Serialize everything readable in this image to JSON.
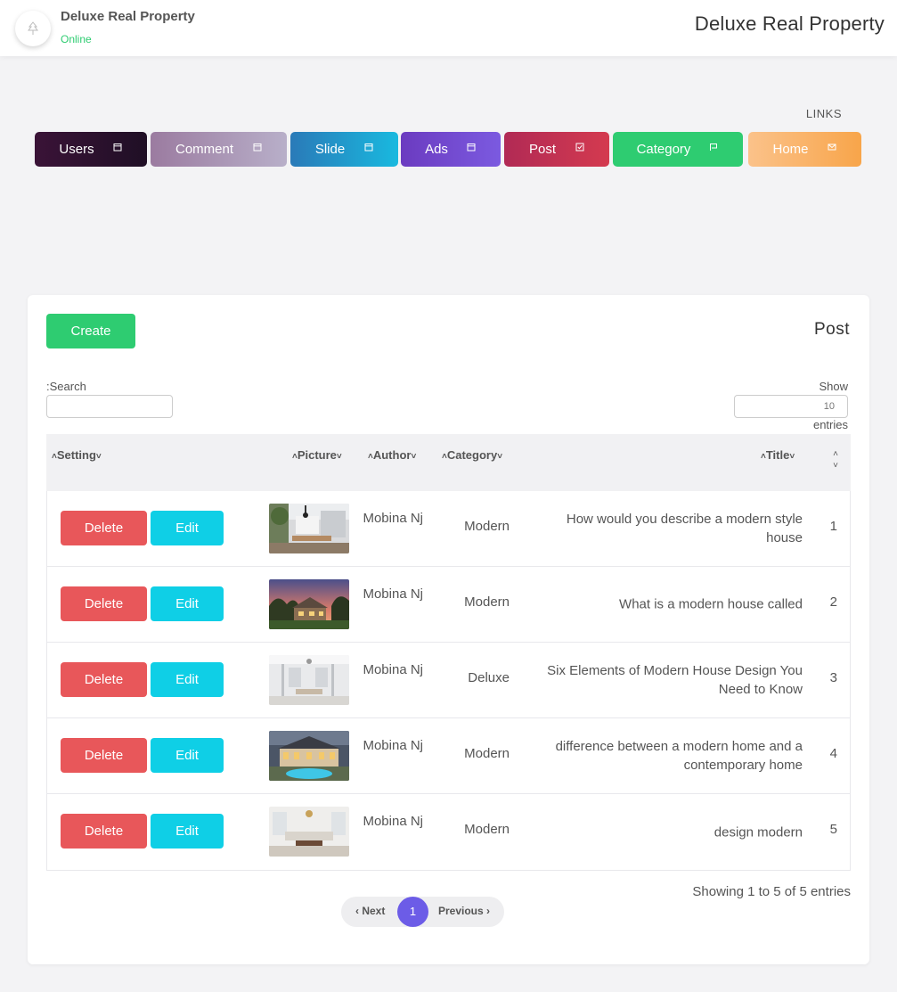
{
  "header": {
    "brand": "Deluxe Real Property",
    "status": "Online",
    "page_heading": "Deluxe Real Property",
    "status_color": "#2ecc71"
  },
  "links": {
    "label": "LINKS",
    "items": [
      {
        "label": "Users",
        "icon": "calendar-icon"
      },
      {
        "label": "Comment",
        "icon": "calendar-icon"
      },
      {
        "label": "Slide",
        "icon": "calendar-icon"
      },
      {
        "label": "Ads",
        "icon": "calendar-icon"
      },
      {
        "label": "Post",
        "icon": "checkbox-icon"
      },
      {
        "label": "Category",
        "icon": "flag-icon"
      },
      {
        "label": "Home",
        "icon": "mail-icon"
      }
    ]
  },
  "card": {
    "create_label": "Create",
    "title": "Post",
    "search_label": ":Search",
    "search_value": "",
    "show_label": "Show",
    "show_value": "10",
    "entries_label": "entries"
  },
  "table": {
    "columns": {
      "setting": "Setting",
      "picture": "Picture",
      "author": "Author",
      "category": "Category",
      "title": "Title"
    },
    "delete_label": "Delete",
    "edit_label": "Edit",
    "rows": [
      {
        "author": "Mobina Nj",
        "category": "Modern",
        "title": "How would you describe a modern style house",
        "num": "1",
        "picture": "modern-interior-photo"
      },
      {
        "author": "Mobina Nj",
        "category": "Modern",
        "title": "What is a modern house called",
        "num": "2",
        "picture": "house-sunset-photo"
      },
      {
        "author": "Mobina Nj",
        "category": "Deluxe",
        "title": "Six Elements of Modern House Design You Need to Know",
        "num": "3",
        "picture": "white-interior-photo"
      },
      {
        "author": "Mobina Nj",
        "category": "Modern",
        "title": "difference between a modern home and a contemporary home",
        "num": "4",
        "picture": "mansion-pool-photo"
      },
      {
        "author": "Mobina Nj",
        "category": "Modern",
        "title": "design modern",
        "num": "5",
        "picture": "living-room-photo"
      }
    ]
  },
  "footer": {
    "showing": "Showing 1 to 5 of 5 entries",
    "pager_next": "Next",
    "pager_page": "1",
    "pager_prev": "Previous"
  },
  "colors": {
    "delete": "#e8575a",
    "edit": "#0fcfe6",
    "create": "#2ecc71",
    "active_page": "#6c5ce7"
  }
}
